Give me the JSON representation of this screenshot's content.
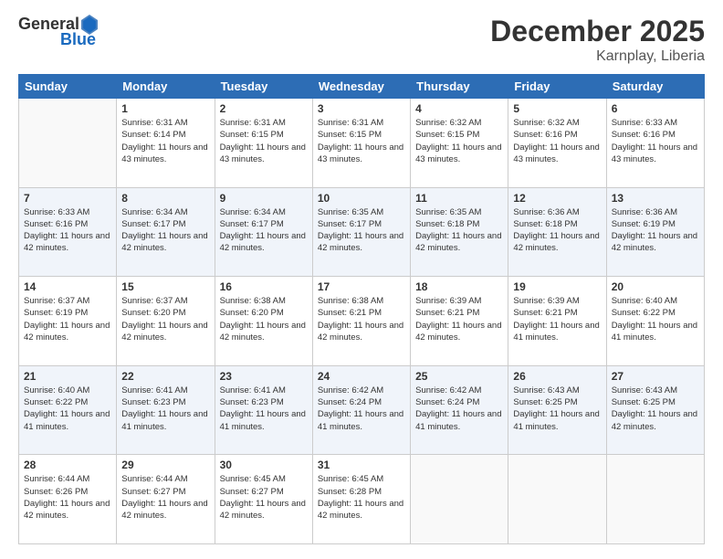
{
  "header": {
    "logo_general": "General",
    "logo_blue": "Blue",
    "month": "December 2025",
    "location": "Karnplay, Liberia"
  },
  "days_of_week": [
    "Sunday",
    "Monday",
    "Tuesday",
    "Wednesday",
    "Thursday",
    "Friday",
    "Saturday"
  ],
  "weeks": [
    [
      {
        "day": "",
        "empty": true
      },
      {
        "day": "1",
        "sunrise": "6:31 AM",
        "sunset": "6:14 PM",
        "daylight": "11 hours and 43 minutes."
      },
      {
        "day": "2",
        "sunrise": "6:31 AM",
        "sunset": "6:15 PM",
        "daylight": "11 hours and 43 minutes."
      },
      {
        "day": "3",
        "sunrise": "6:31 AM",
        "sunset": "6:15 PM",
        "daylight": "11 hours and 43 minutes."
      },
      {
        "day": "4",
        "sunrise": "6:32 AM",
        "sunset": "6:15 PM",
        "daylight": "11 hours and 43 minutes."
      },
      {
        "day": "5",
        "sunrise": "6:32 AM",
        "sunset": "6:16 PM",
        "daylight": "11 hours and 43 minutes."
      },
      {
        "day": "6",
        "sunrise": "6:33 AM",
        "sunset": "6:16 PM",
        "daylight": "11 hours and 43 minutes."
      }
    ],
    [
      {
        "day": "7",
        "sunrise": "6:33 AM",
        "sunset": "6:16 PM",
        "daylight": "11 hours and 42 minutes."
      },
      {
        "day": "8",
        "sunrise": "6:34 AM",
        "sunset": "6:17 PM",
        "daylight": "11 hours and 42 minutes."
      },
      {
        "day": "9",
        "sunrise": "6:34 AM",
        "sunset": "6:17 PM",
        "daylight": "11 hours and 42 minutes."
      },
      {
        "day": "10",
        "sunrise": "6:35 AM",
        "sunset": "6:17 PM",
        "daylight": "11 hours and 42 minutes."
      },
      {
        "day": "11",
        "sunrise": "6:35 AM",
        "sunset": "6:18 PM",
        "daylight": "11 hours and 42 minutes."
      },
      {
        "day": "12",
        "sunrise": "6:36 AM",
        "sunset": "6:18 PM",
        "daylight": "11 hours and 42 minutes."
      },
      {
        "day": "13",
        "sunrise": "6:36 AM",
        "sunset": "6:19 PM",
        "daylight": "11 hours and 42 minutes."
      }
    ],
    [
      {
        "day": "14",
        "sunrise": "6:37 AM",
        "sunset": "6:19 PM",
        "daylight": "11 hours and 42 minutes."
      },
      {
        "day": "15",
        "sunrise": "6:37 AM",
        "sunset": "6:20 PM",
        "daylight": "11 hours and 42 minutes."
      },
      {
        "day": "16",
        "sunrise": "6:38 AM",
        "sunset": "6:20 PM",
        "daylight": "11 hours and 42 minutes."
      },
      {
        "day": "17",
        "sunrise": "6:38 AM",
        "sunset": "6:21 PM",
        "daylight": "11 hours and 42 minutes."
      },
      {
        "day": "18",
        "sunrise": "6:39 AM",
        "sunset": "6:21 PM",
        "daylight": "11 hours and 42 minutes."
      },
      {
        "day": "19",
        "sunrise": "6:39 AM",
        "sunset": "6:21 PM",
        "daylight": "11 hours and 41 minutes."
      },
      {
        "day": "20",
        "sunrise": "6:40 AM",
        "sunset": "6:22 PM",
        "daylight": "11 hours and 41 minutes."
      }
    ],
    [
      {
        "day": "21",
        "sunrise": "6:40 AM",
        "sunset": "6:22 PM",
        "daylight": "11 hours and 41 minutes."
      },
      {
        "day": "22",
        "sunrise": "6:41 AM",
        "sunset": "6:23 PM",
        "daylight": "11 hours and 41 minutes."
      },
      {
        "day": "23",
        "sunrise": "6:41 AM",
        "sunset": "6:23 PM",
        "daylight": "11 hours and 41 minutes."
      },
      {
        "day": "24",
        "sunrise": "6:42 AM",
        "sunset": "6:24 PM",
        "daylight": "11 hours and 41 minutes."
      },
      {
        "day": "25",
        "sunrise": "6:42 AM",
        "sunset": "6:24 PM",
        "daylight": "11 hours and 41 minutes."
      },
      {
        "day": "26",
        "sunrise": "6:43 AM",
        "sunset": "6:25 PM",
        "daylight": "11 hours and 41 minutes."
      },
      {
        "day": "27",
        "sunrise": "6:43 AM",
        "sunset": "6:25 PM",
        "daylight": "11 hours and 42 minutes."
      }
    ],
    [
      {
        "day": "28",
        "sunrise": "6:44 AM",
        "sunset": "6:26 PM",
        "daylight": "11 hours and 42 minutes."
      },
      {
        "day": "29",
        "sunrise": "6:44 AM",
        "sunset": "6:27 PM",
        "daylight": "11 hours and 42 minutes."
      },
      {
        "day": "30",
        "sunrise": "6:45 AM",
        "sunset": "6:27 PM",
        "daylight": "11 hours and 42 minutes."
      },
      {
        "day": "31",
        "sunrise": "6:45 AM",
        "sunset": "6:28 PM",
        "daylight": "11 hours and 42 minutes."
      },
      {
        "day": "",
        "empty": true
      },
      {
        "day": "",
        "empty": true
      },
      {
        "day": "",
        "empty": true
      }
    ]
  ],
  "labels": {
    "sunrise_prefix": "Sunrise: ",
    "sunset_prefix": "Sunset: ",
    "daylight_prefix": "Daylight: "
  }
}
